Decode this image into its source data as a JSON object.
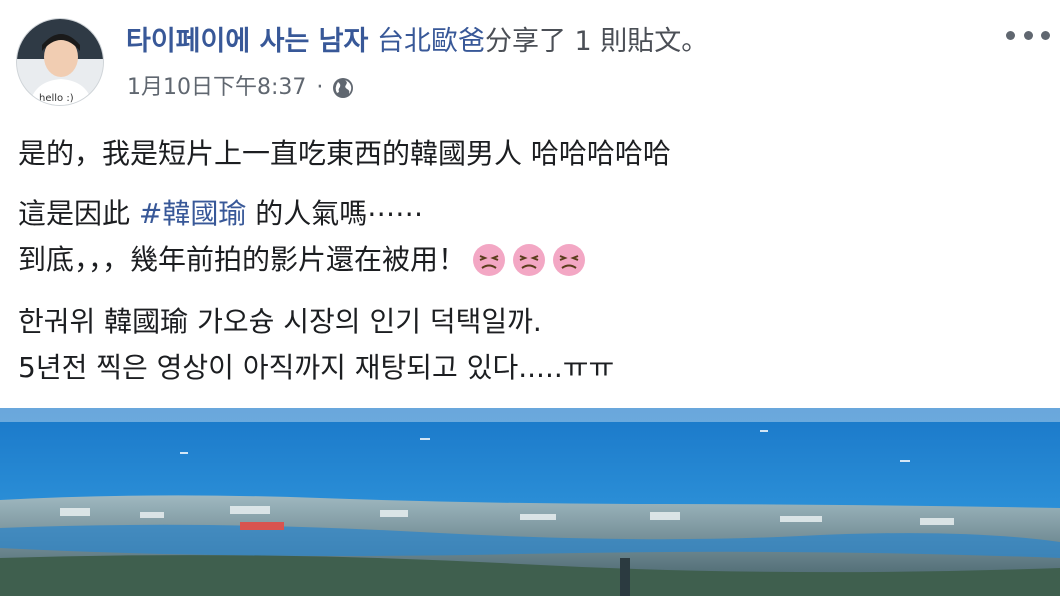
{
  "post": {
    "author": "타이페이에 사는 남자",
    "shared_page": "台北歐爸",
    "action_text": "分享了 1 則貼文。",
    "timestamp": "1月10日下午8:37",
    "separator": "·",
    "privacy_icon": "globe-icon",
    "avatar_caption": "hello :)"
  },
  "content": {
    "line1": "是的，我是短片上一直吃東西的韓國男人 哈哈哈哈哈",
    "line2_prefix": "這是因此 ",
    "hashtag": "#韓國瑜",
    "line2_suffix": " 的人氣嗎⋯⋯",
    "line3": "到底，，，幾年前拍的影片還在被用！",
    "emoji_name": "persevering-face-emoji",
    "korean_line1": "한궈위 韓國瑜 가오슝 시장의 인기 덕택일까.",
    "korean_line2": "5년전 찍은 영상이 아직까지 재탕되고 있다.....ㅠㅠ"
  },
  "colors": {
    "link": "#385898",
    "text": "#1c1e21",
    "meta": "#606770",
    "emoji": "#f29ab8"
  }
}
